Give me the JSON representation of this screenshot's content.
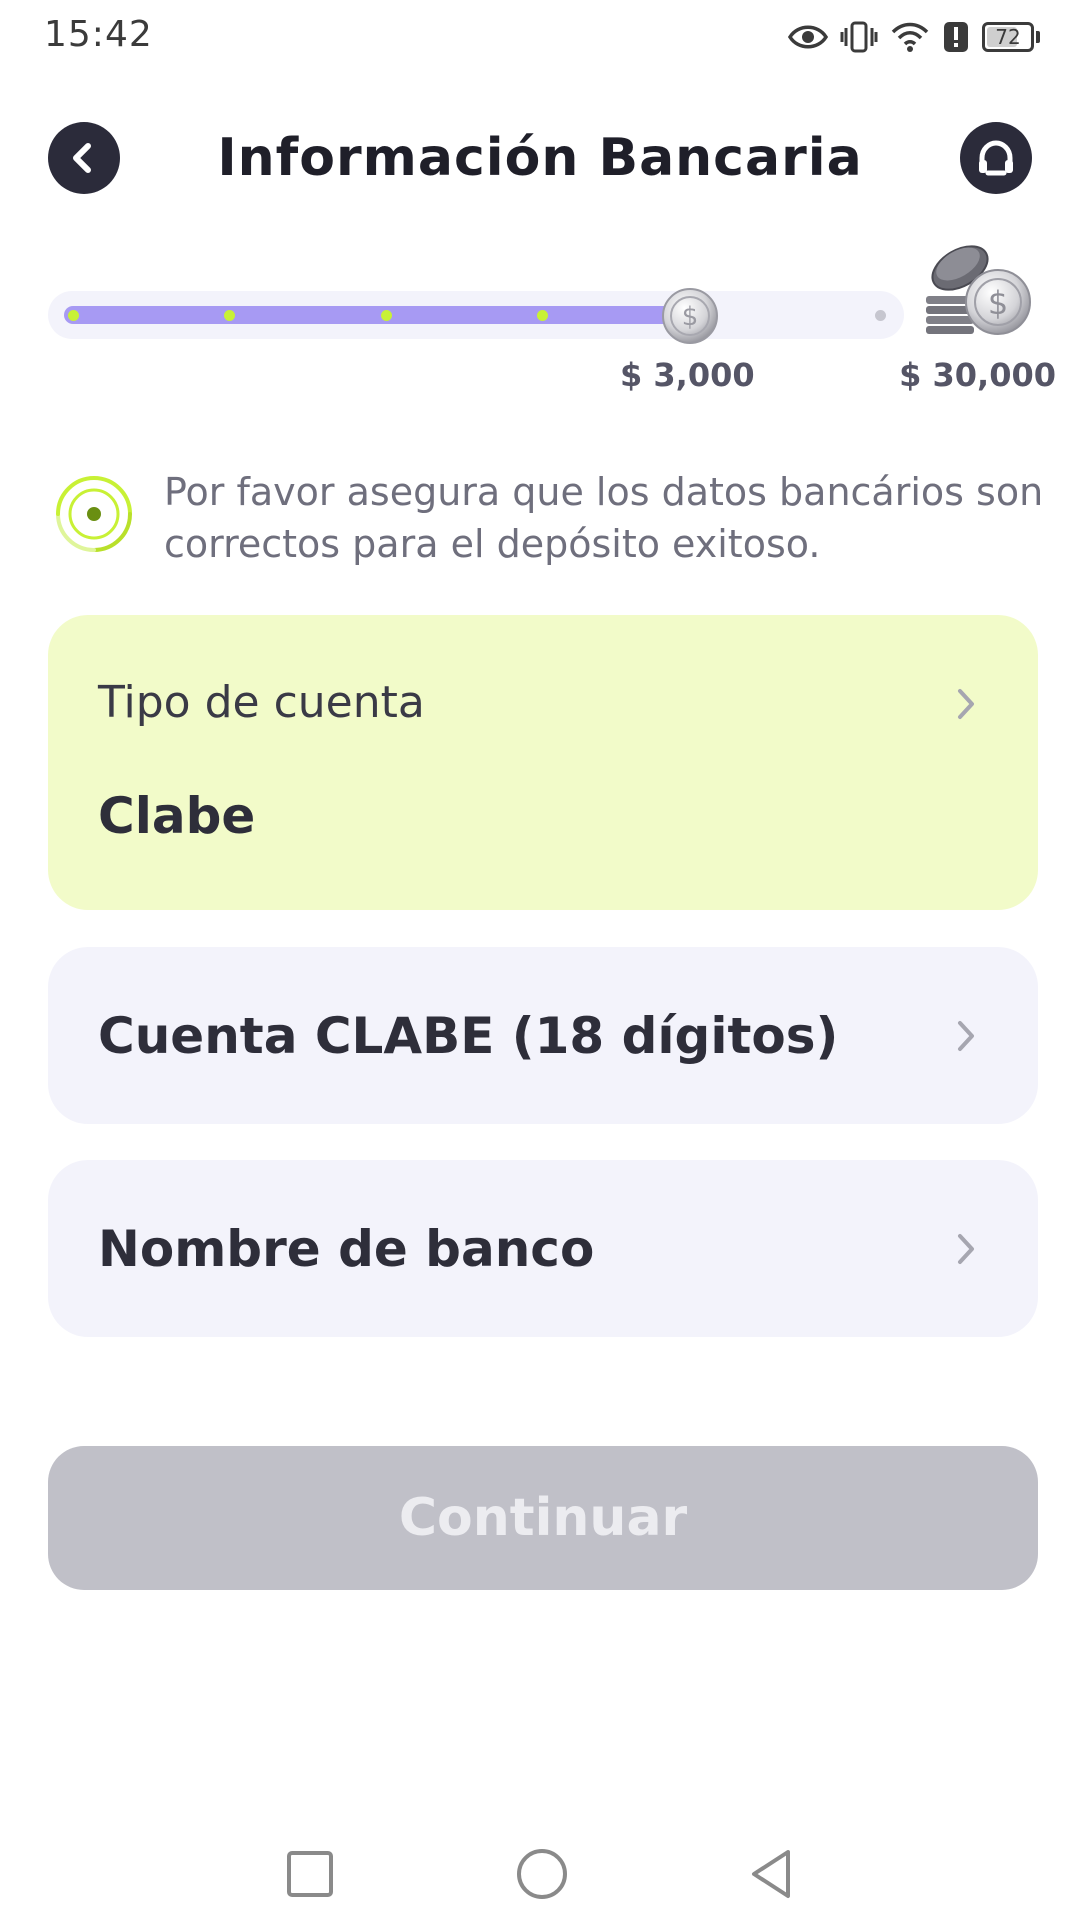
{
  "status_bar": {
    "time": "15:42",
    "battery": "72",
    "battery_level": 0.72,
    "icons": [
      "eye-icon",
      "vibrate-icon",
      "wifi-icon",
      "alert-icon",
      "battery-icon"
    ]
  },
  "header": {
    "title": "Información Bancaria",
    "back_icon": "chevron-left-icon",
    "support_icon": "headset-icon"
  },
  "progress": {
    "current_amount": "$ 3,000",
    "target_amount": "$ 30,000",
    "fill_fraction": 0.76,
    "milestones": 4
  },
  "notice": {
    "text": "Por favor asegura que los datos bancários son correctos para el depósito exitoso."
  },
  "form": {
    "account_type": {
      "label": "Tipo de cuenta",
      "value": "Clabe"
    },
    "clabe": {
      "label": "Cuenta CLABE (18 dígitos)"
    },
    "bank_name": {
      "label": "Nombre de banco"
    }
  },
  "continue_button": {
    "label": "Continuar",
    "enabled": false
  },
  "nav_bar": {
    "buttons": [
      "recents-square-icon",
      "home-circle-icon",
      "back-triangle-icon"
    ]
  },
  "colors": {
    "accent": "#a79af3",
    "highlight": "#c8f135",
    "card_selected": "#f2fbc9",
    "card": "#f3f3fb",
    "disabled_button": "#c0c0c8",
    "dark": "#2b2b3a"
  }
}
